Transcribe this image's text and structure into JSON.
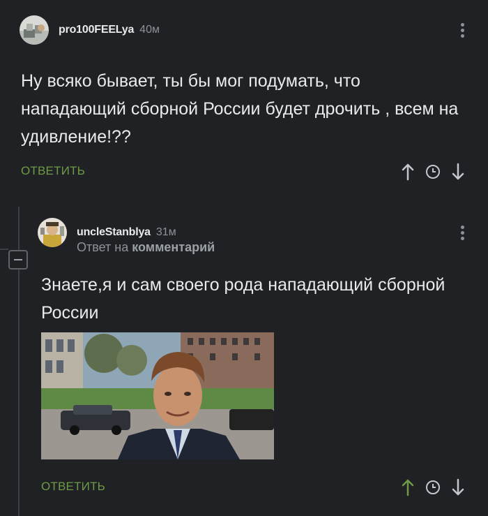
{
  "comments": [
    {
      "username": "pro100FEELya",
      "time": "40м",
      "text": "Ну всяко бывает, ты бы мог подумать, что нападающий сборной России будет дрочить , всем на удивление!??",
      "reply_label": "ОТВЕТИТЬ",
      "upvote_icon": "arrow-up-icon",
      "history_icon": "clock-icon",
      "downvote_icon": "arrow-down-icon"
    },
    {
      "username": "uncleStanblya",
      "time": "31м",
      "reply_to_prefix": "Ответ на",
      "reply_to_link": "комментарий",
      "text": "Знаете,я и сам своего рода нападающий сборной России",
      "reply_label": "ОТВЕТИТЬ",
      "upvote_active": true,
      "upvote_icon": "arrow-up-icon",
      "history_icon": "clock-icon",
      "downvote_icon": "arrow-down-icon"
    }
  ],
  "colors": {
    "background": "#202124",
    "accent_green": "#6e9b47",
    "muted": "#8e9196"
  }
}
